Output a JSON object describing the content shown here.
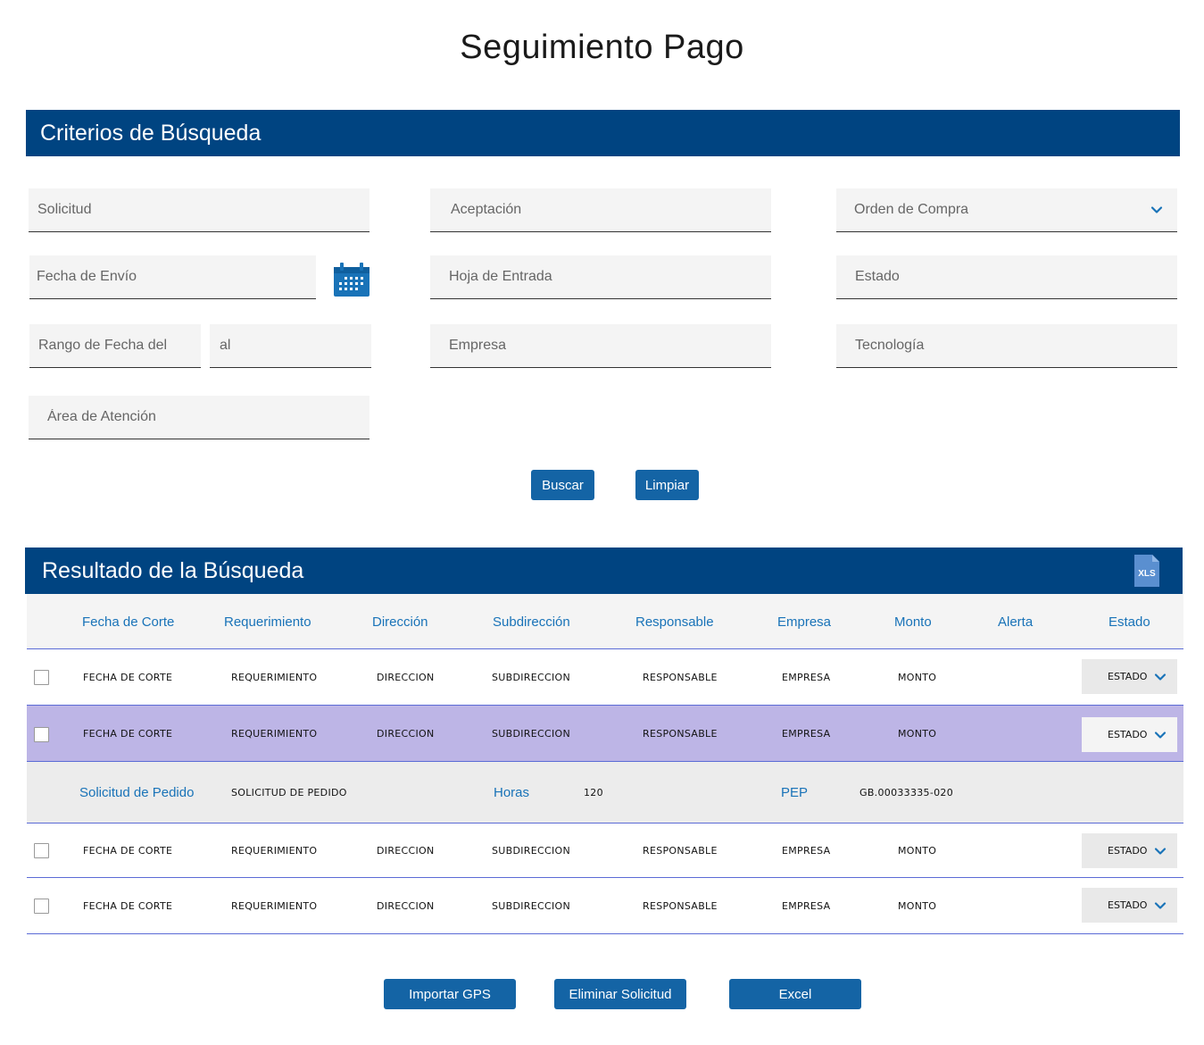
{
  "page_title": "Seguimiento Pago",
  "criteria": {
    "title": "Criterios de Búsqueda",
    "solicitud": "Solicitud",
    "aceptacion": "Aceptación",
    "orden_compra": "Orden de Compra",
    "fecha_envio": "Fecha de Envío",
    "hoja_entrada": "Hoja de Entrada",
    "estado": "Estado",
    "rango_del": "Rango de Fecha del",
    "rango_al": "al",
    "empresa": "Empresa",
    "tecnologia": "Tecnología",
    "area_atencion": "Área de Atención",
    "buscar": "Buscar",
    "limpiar": "Limpiar"
  },
  "results": {
    "title": "Resultado de la Búsqueda",
    "xls_label": "XLS",
    "columns": [
      "Fecha de Corte",
      "Requerimiento",
      "Dirección",
      "Subdirección",
      "Responsable",
      "Empresa",
      "Monto",
      "Alerta",
      "Estado"
    ],
    "rows": [
      {
        "fecha": "FECHA DE CORTE",
        "req": "REQUERIMIENTO",
        "dir": "DIRECCION",
        "subdir": "SUBDIRECCION",
        "resp": "RESPONSABLE",
        "empresa": "EMPRESA",
        "monto": "MONTO",
        "estado": "ESTADO",
        "selected": false
      },
      {
        "fecha": "FECHA DE CORTE",
        "req": "REQUERIMIENTO",
        "dir": "DIRECCION",
        "subdir": "SUBDIRECCION",
        "resp": "RESPONSABLE",
        "empresa": "EMPRESA",
        "monto": "MONTO",
        "estado": "ESTADO",
        "selected": true
      },
      {
        "fecha": "FECHA DE CORTE",
        "req": "REQUERIMIENTO",
        "dir": "DIRECCION",
        "subdir": "SUBDIRECCION",
        "resp": "RESPONSABLE",
        "empresa": "EMPRESA",
        "monto": "MONTO",
        "estado": "ESTADO",
        "selected": false
      },
      {
        "fecha": "FECHA DE CORTE",
        "req": "REQUERIMIENTO",
        "dir": "DIRECCION",
        "subdir": "SUBDIRECCION",
        "resp": "RESPONSABLE",
        "empresa": "EMPRESA",
        "monto": "MONTO",
        "estado": "ESTADO",
        "selected": false
      }
    ],
    "detail": {
      "solicitud_label": "Solicitud de Pedido",
      "solicitud_value": "SOLICITUD DE PEDIDO",
      "horas_label": "Horas",
      "horas_value": "120",
      "pep_label": "PEP",
      "pep_value": "GB.00033335-020"
    }
  },
  "footer": {
    "importar": "Importar GPS",
    "eliminar": "Eliminar Solicitud",
    "excel": "Excel"
  },
  "colors": {
    "brand_navy": "#004481",
    "button_blue": "#1464a5",
    "link_blue": "#1973b8",
    "selected_row": "#bdb5e6",
    "detail_row": "#ececec",
    "row_divider": "#5b6bd6"
  },
  "icons": [
    "calendar-icon",
    "chevron-down-icon",
    "xls-file-icon",
    "checkbox"
  ]
}
